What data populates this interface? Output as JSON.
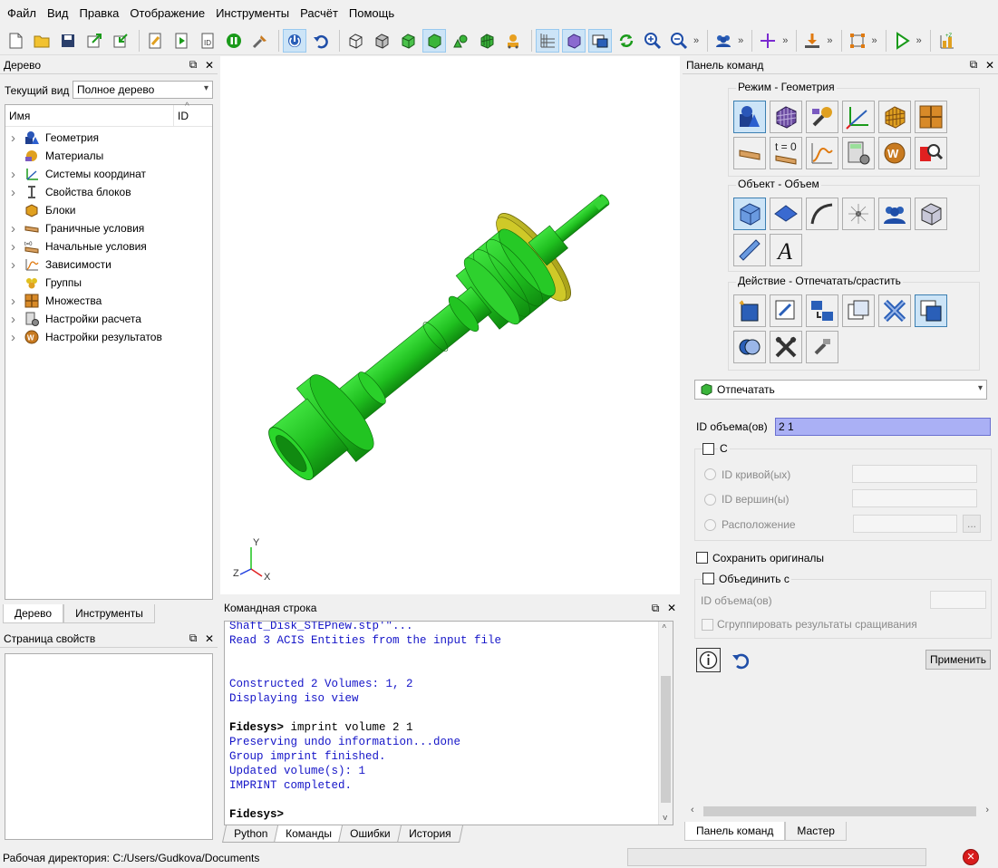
{
  "menu": [
    "Файл",
    "Вид",
    "Правка",
    "Отображение",
    "Инструменты",
    "Расчёт",
    "Помощь"
  ],
  "toolbar": {
    "icons": [
      "new-file-icon",
      "open-folder-icon",
      "save-icon",
      "export-icon",
      "import-icon",
      "edit-script-icon",
      "run-script-icon",
      "id-icon",
      "pause-icon",
      "tools-icon",
      "select-icon",
      "undo-icon",
      "wireframe-icon",
      "hidden-icon",
      "shaded-icon",
      "smooth-shade-icon",
      "volume-icon",
      "mesh-icon",
      "group-icon",
      "axes-icon",
      "cube-icon",
      "view-icon",
      "refresh-icon",
      "zoom-in-icon",
      "zoom-out-icon"
    ],
    "more": "»"
  },
  "tree_panel": {
    "title": "Дерево",
    "view_label": "Текущий вид",
    "view_value": "Полное дерево",
    "col_name": "Имя",
    "col_id": "ID",
    "items": [
      {
        "label": "Геометрия",
        "expandable": true,
        "icon": "geometry-icon"
      },
      {
        "label": "Материалы",
        "expandable": false,
        "icon": "materials-icon"
      },
      {
        "label": "Системы координат",
        "expandable": true,
        "icon": "coordinate-systems-icon"
      },
      {
        "label": "Свойства блоков",
        "expandable": true,
        "icon": "block-properties-icon"
      },
      {
        "label": "Блоки",
        "expandable": false,
        "icon": "blocks-icon"
      },
      {
        "label": "Граничные условия",
        "expandable": true,
        "icon": "boundary-conditions-icon"
      },
      {
        "label": "Начальные условия",
        "expandable": true,
        "icon": "initial-conditions-icon"
      },
      {
        "label": "Зависимости",
        "expandable": true,
        "icon": "dependencies-icon"
      },
      {
        "label": "Группы",
        "expandable": false,
        "icon": "groups-icon"
      },
      {
        "label": "Множества",
        "expandable": true,
        "icon": "sets-icon"
      },
      {
        "label": "Настройки расчета",
        "expandable": true,
        "icon": "calc-settings-icon"
      },
      {
        "label": "Настройки результатов",
        "expandable": true,
        "icon": "result-settings-icon"
      }
    ],
    "tabs": [
      "Дерево",
      "Инструменты"
    ]
  },
  "properties_panel": {
    "title": "Страница свойств"
  },
  "viewport": {
    "axis_x": "X",
    "axis_y": "Y",
    "axis_z": "Z"
  },
  "command_line": {
    "title": "Командная строка",
    "lines": [
      {
        "text": "Shaft_Disk_STEPnew.stp'\"...",
        "kind": "blue"
      },
      {
        "text": "Read 3 ACIS Entities from the input file",
        "kind": "blue"
      },
      {
        "text": "",
        "kind": "blue"
      },
      {
        "text": "",
        "kind": "blue"
      },
      {
        "text": "Constructed 2 Volumes: 1, 2",
        "kind": "blue"
      },
      {
        "text": "Displaying iso view",
        "kind": "blue"
      },
      {
        "text": "",
        "kind": "blue"
      },
      {
        "text": "Fidesys> imprint volume 2 1",
        "kind": "black"
      },
      {
        "text": "Preserving undo information...done",
        "kind": "blue"
      },
      {
        "text": "Group imprint finished.",
        "kind": "blue"
      },
      {
        "text": "Updated volume(s): 1",
        "kind": "blue"
      },
      {
        "text": "IMPRINT completed.",
        "kind": "blue"
      },
      {
        "text": "",
        "kind": "blue"
      },
      {
        "text": "Fidesys>",
        "kind": "black"
      }
    ],
    "tabs": [
      "Python",
      "Команды",
      "Ошибки",
      "История"
    ]
  },
  "command_panel": {
    "title": "Панель команд",
    "mode_group": "Режим - Геометрия",
    "object_group": "Объект - Объем",
    "action_group": "Действие - Отпечатать/срастить",
    "operation": "Отпечатать",
    "volume_id_label": "ID объема(ов)",
    "volume_id_value": "2 1",
    "with_label": "С",
    "curve_id_label": "ID кривой(ых)",
    "vertex_id_label": "ID вершин(ы)",
    "location_label": "Расположение",
    "browse_label": "...",
    "keep_originals_label": "Сохранить оригиналы",
    "merge_with_label": "Объединить с",
    "merge_volume_id_label": "ID объема(ов)",
    "group_results_label": "Сгруппировать результаты сращивания",
    "apply_label": "Применить",
    "tabs": [
      "Панель команд",
      "Мастер"
    ]
  },
  "status": {
    "working_dir": "Рабочая директория: C:/Users/Gudkova/Documents"
  }
}
